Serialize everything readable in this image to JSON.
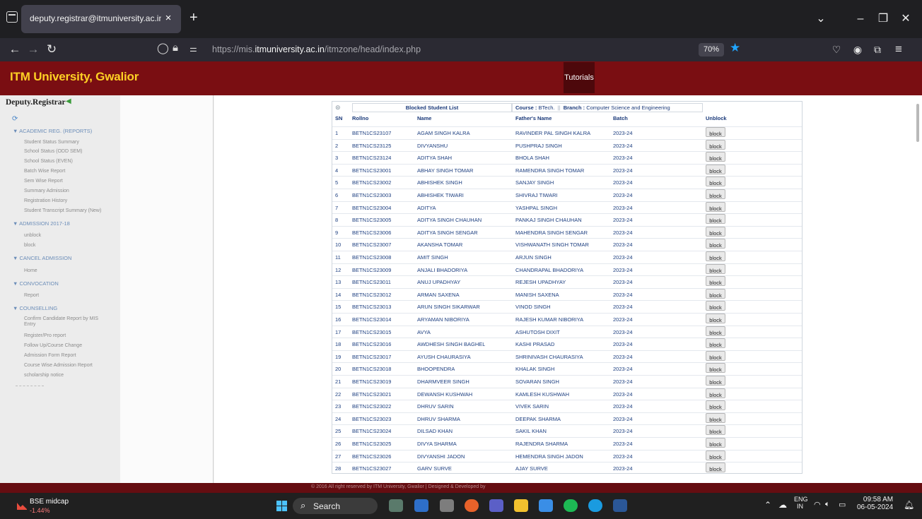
{
  "browser": {
    "tab_title": "deputy.registrar@itmuniversity.ac.in",
    "tab_close": "×",
    "new_tab": "+",
    "window_controls": [
      "⌄",
      "–",
      "❐",
      "✕"
    ],
    "url_prefix": "https://mis.",
    "url_domain": "itmuniversity.ac.in",
    "url_path": "/itmzone/head/index.php",
    "zoom": "70%"
  },
  "header": {
    "brand": "ITM University, Gwalior",
    "tutorials": "Tutorials"
  },
  "sidebar": {
    "title": "Deputy.Registrar",
    "sections": [
      {
        "label": "▼ ACADEMIC REG. (REPORTS)",
        "items": [
          "Student Status Summary",
          "School Status (ODD SEM)",
          "School Status (EVEN)",
          "Batch Wise Report",
          "Sem Wise Report",
          "Summary Admission",
          "Registration History",
          "Student Transcript Summary (New)"
        ]
      },
      {
        "label": "▼ ADMISSION 2017-18",
        "items": [
          "unblock",
          "block"
        ]
      },
      {
        "label": "▼ CANCEL ADMISSION",
        "items": [
          "Home"
        ]
      },
      {
        "label": "▼ CONVOCATION",
        "items": [
          "Report"
        ]
      },
      {
        "label": "▼ COUNSELLING",
        "items": [
          "Confirm Candidate Report by MIS Entry",
          "Register/Pro report",
          "Follow Up/Course Change",
          "Admission Form Report",
          "Course Wise Admission Report",
          "scholarship notice"
        ]
      }
    ]
  },
  "table": {
    "title": "Blocked Student List",
    "course_label": "Course :",
    "course_value": "BTech.",
    "separator": "||",
    "branch_label": "Branch :",
    "branch_value": "Computer Science and Engineering",
    "columns": [
      "SN",
      "Rollno",
      "Name",
      "Father's Name",
      "Batch",
      "Unblock"
    ],
    "button_label": "block",
    "rows": [
      [
        "1",
        "BETN1CS23107",
        "AGAM SINGH KALRA",
        "RAVINDER PAL SINGH KALRA",
        "2023-24"
      ],
      [
        "2",
        "BETN1CS23125",
        "DIVYANSHU",
        "PUSHPRAJ SINGH",
        "2023-24"
      ],
      [
        "3",
        "BETN1CS23124",
        "ADITYA SHAH",
        "BHOLA SHAH",
        "2023-24"
      ],
      [
        "4",
        "BETN1CS23001",
        "ABHAY SINGH TOMAR",
        "RAMENDRA SINGH TOMAR",
        "2023-24"
      ],
      [
        "5",
        "BETN1CS23002",
        "ABHISHEK SINGH",
        "SANJAY SINGH",
        "2023-24"
      ],
      [
        "6",
        "BETN1CS23003",
        "ABHISHEK TIWARI",
        "SHIVRAJ TIWARI",
        "2023-24"
      ],
      [
        "7",
        "BETN1CS23004",
        "ADITYA",
        "YASHPAL SINGH",
        "2023-24"
      ],
      [
        "8",
        "BETN1CS23005",
        "ADITYA SINGH CHAUHAN",
        "PANKAJ SINGH CHAUHAN",
        "2023-24"
      ],
      [
        "9",
        "BETN1CS23006",
        "ADITYA SINGH SENGAR",
        "MAHENDRA SINGH SENGAR",
        "2023-24"
      ],
      [
        "10",
        "BETN1CS23007",
        "AKANSHA TOMAR",
        "VISHWANATH SINGH TOMAR",
        "2023-24"
      ],
      [
        "11",
        "BETN1CS23008",
        "AMIT SINGH",
        "ARJUN SINGH",
        "2023-24"
      ],
      [
        "12",
        "BETN1CS23009",
        "ANJALI BHADORIYA",
        "CHANDRAPAL BHADORIYA",
        "2023-24"
      ],
      [
        "13",
        "BETN1CS23011",
        "ANUJ UPADHYAY",
        "REJESH UPADHYAY",
        "2023-24"
      ],
      [
        "14",
        "BETN1CS23012",
        "ARMAN SAXENA",
        "MANISH SAXENA",
        "2023-24"
      ],
      [
        "15",
        "BETN1CS23013",
        "ARUN SINGH SIKARWAR",
        "VINOD SINGH",
        "2023-24"
      ],
      [
        "16",
        "BETN1CS23014",
        "ARYAMAN NIBORIYA",
        "RAJESH KUMAR NIBORIYA",
        "2023-24"
      ],
      [
        "17",
        "BETN1CS23015",
        "AVYA",
        "ASHUTOSH DIXIT",
        "2023-24"
      ],
      [
        "18",
        "BETN1CS23016",
        "AWDHESH SINGH BAGHEL",
        "KASHI PRASAD",
        "2023-24"
      ],
      [
        "19",
        "BETN1CS23017",
        "AYUSH CHAURASIYA",
        "SHRINIVASH CHAURASIYA",
        "2023-24"
      ],
      [
        "20",
        "BETN1CS23018",
        "BHOOPENDRA",
        "KHALAK SINGH",
        "2023-24"
      ],
      [
        "21",
        "BETN1CS23019",
        "DHARMVEER SINGH",
        "SOVARAN SINGH",
        "2023-24"
      ],
      [
        "22",
        "BETN1CS23021",
        "DEWANSH KUSHWAH",
        "KAMLESH KUSHWAH",
        "2023-24"
      ],
      [
        "23",
        "BETN1CS23022",
        "DHRUV SARIN",
        "VIVEK SARIN",
        "2023-24"
      ],
      [
        "24",
        "BETN1CS23023",
        "DHRUV SHARMA",
        "DEEPAK SHARMA",
        "2023-24"
      ],
      [
        "25",
        "BETN1CS23024",
        "DILSAD KHAN",
        "SAKIL KHAN",
        "2023-24"
      ],
      [
        "26",
        "BETN1CS23025",
        "DIVYA SHARMA",
        "RAJENDRA SHARMA",
        "2023-24"
      ],
      [
        "27",
        "BETN1CS23026",
        "DIVYANSHI JADON",
        "HEMENDRA SINGH JADON",
        "2023-24"
      ],
      [
        "28",
        "BETN1CS23027",
        "GARV SURVE",
        "AJAY SURVE",
        "2023-24"
      ]
    ]
  },
  "footer": {
    "text": "© 2016 All right reserved by ITM University, Gwalior | Designed & Developed by"
  },
  "taskbar": {
    "stock_name": "BSE midcap",
    "stock_change": "-1.44%",
    "search_label": "Search",
    "lang_line1": "ENG",
    "lang_line2": "IN",
    "time": "09:58 AM",
    "date": "06-05-2024"
  },
  "colors": {
    "header_bg": "#7a0e12",
    "brand_text": "#ffd024",
    "table_text": "#1d3f80"
  }
}
